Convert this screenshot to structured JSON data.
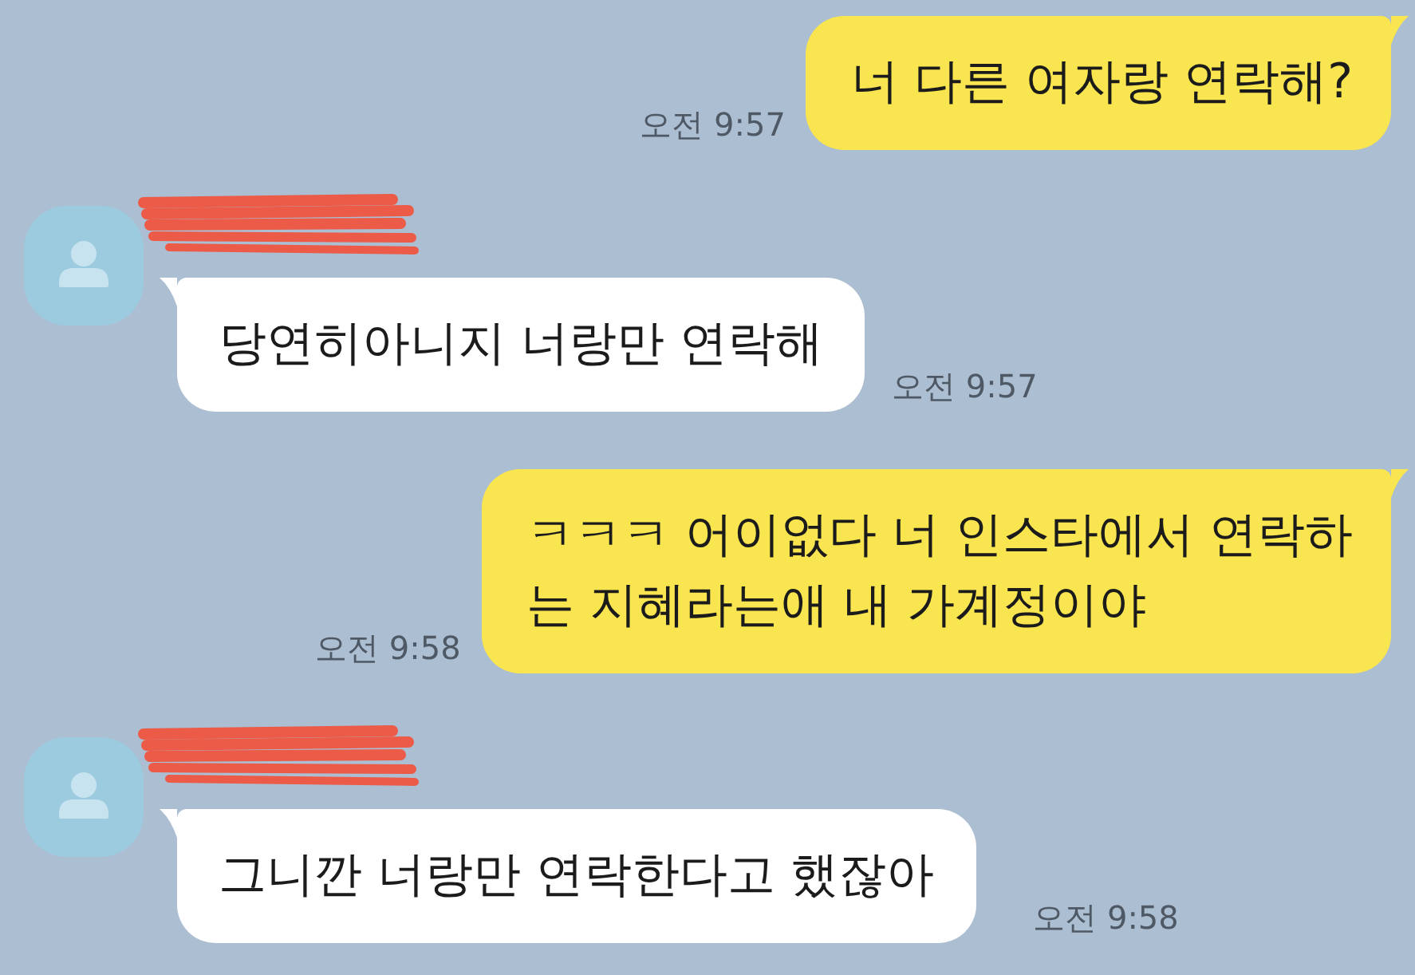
{
  "messages": [
    {
      "kind": "sent",
      "lines": [
        "너 다른 여자랑 연락해?"
      ],
      "time": "오전 9:57"
    },
    {
      "kind": "received",
      "name_redacted": true,
      "lines": [
        "당연히아니지 너랑만 연락해"
      ],
      "time": "오전 9:57"
    },
    {
      "kind": "sent",
      "lines": [
        "ㅋㅋㅋ 어이없다 너 인스타에서 연락하",
        "는 지혜라는애 내 가계정이야"
      ],
      "time": "오전 9:58"
    },
    {
      "kind": "received",
      "name_redacted": true,
      "lines": [
        "그니깐 너랑만 연락한다고 했잖아"
      ],
      "time": "오전 9:58"
    }
  ]
}
